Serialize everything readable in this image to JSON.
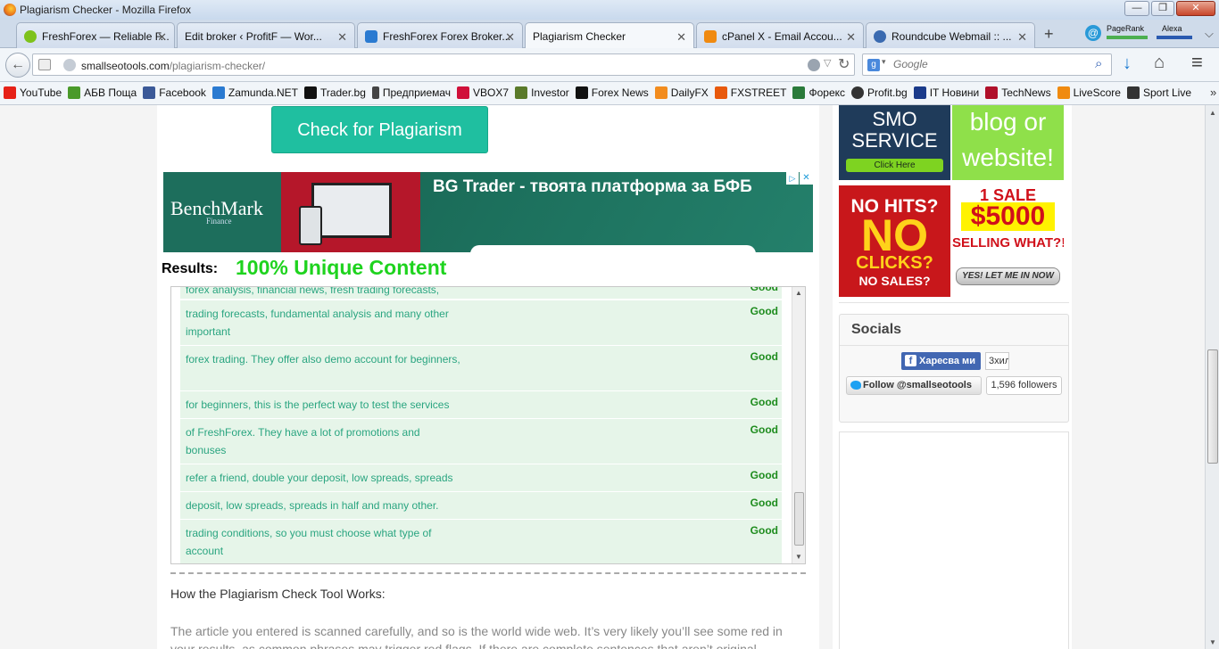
{
  "window": {
    "title": "Plagiarism Checker - Mozilla Firefox",
    "minimize": "—",
    "maximize": "❐",
    "close": "✕"
  },
  "tabs": [
    {
      "label": "FreshForex — Reliable F...",
      "close": "✕"
    },
    {
      "label": "Edit broker ‹ ProfitF — Wor...",
      "close": "✕"
    },
    {
      "label": "FreshForex Forex Broker...",
      "close": "✕"
    },
    {
      "label": "Plagiarism Checker",
      "close": "✕"
    },
    {
      "label": "cPanel X - Email Accou...",
      "close": "✕"
    },
    {
      "label": "Roundcube Webmail :: ...",
      "close": "✕"
    }
  ],
  "tabbar": {
    "new_tab": "+",
    "pagerank": "PageRank",
    "alexa": "Alexa",
    "list_tabs": "⌵"
  },
  "nav": {
    "back": "←",
    "url_domain": "smallseotools.com",
    "url_path": "/plagiarism-checker/",
    "search_placeholder": "Google",
    "downloads": "↓",
    "home": "⌂",
    "menu": "≡"
  },
  "bookmarks": [
    {
      "label": "YouTube",
      "color": "#e62117"
    },
    {
      "label": "АБВ Поща",
      "color": "#4a9a2a"
    },
    {
      "label": "Facebook",
      "color": "#3b5998"
    },
    {
      "label": "Zamunda.NET",
      "color": "#2a7ad1"
    },
    {
      "label": "Trader.bg",
      "color": "#111111"
    },
    {
      "label": "Предприемач",
      "color": "#444444"
    },
    {
      "label": "VBOX7",
      "color": "#d0103a"
    },
    {
      "label": "Investor",
      "color": "#5a7a2a"
    },
    {
      "label": "Forex News",
      "color": "#111111"
    },
    {
      "label": "DailyFX",
      "color": "#f28c1e"
    },
    {
      "label": "FXSTREET",
      "color": "#e8590c"
    },
    {
      "label": "Форекс",
      "color": "#2a7a3a"
    },
    {
      "label": "Profit.bg",
      "color": "#333333"
    },
    {
      "label": "IT Новини",
      "color": "#1a3a8a"
    },
    {
      "label": "TechNews",
      "color": "#b0102a"
    },
    {
      "label": "LiveScore",
      "color": "#f08a10"
    },
    {
      "label": "Sport Live",
      "color": "#333333"
    }
  ],
  "bookmarks_more": "»",
  "main": {
    "check_button": "Check for Plagiarism",
    "ad": {
      "brand": "BenchMark",
      "brand_sub": "Finance",
      "headline": "BG Trader - твоята платформа за БФБ",
      "ad_choices": "▷",
      "ad_close": "✕"
    },
    "results_label": "Results:",
    "results_summary": "100% Unique Content",
    "results": [
      {
        "text": "forex analysis, financial news, fresh trading forecasts,",
        "status": "Good"
      },
      {
        "text": "trading forecasts, fundamental analysis and many other important",
        "status": "Good"
      },
      {
        "text": "forex trading. They offer also demo account for beginners,",
        "status": "Good"
      },
      {
        "text": "for beginners, this is the perfect way to test the services",
        "status": "Good"
      },
      {
        "text": "of FreshForex. They have a lot of promotions and bonuses",
        "status": "Good"
      },
      {
        "text": "refer a friend, double your deposit, low spreads, spreads",
        "status": "Good"
      },
      {
        "text": "deposit, low spreads, spreads in half and many other.",
        "status": "Good"
      },
      {
        "text": "trading conditions, so you must choose what type of account",
        "status": "Good"
      }
    ],
    "results_scroll": {
      "up": "▲",
      "down": "▼"
    },
    "how_heading": "How the Plagiarism Check Tool Works:",
    "how_text": "The article you entered is scanned carefully, and so is the world wide web. It’s very likely you’ll see some red in your results, as common phrases may trigger red flags. If there are complete sentences that aren’t original"
  },
  "sidebar": {
    "ads": [
      {
        "line1": "SMO",
        "line2": "SERVICE",
        "button": "Click Here"
      },
      {
        "line1": "blog or",
        "line2": "website!"
      },
      {
        "line1": "NO HITS?",
        "line2": "NO",
        "line3": "CLICKS?",
        "line4": "NO SALES?"
      },
      {
        "line1": "1 SALE",
        "line2": "$5000",
        "line3": "SELLING WHAT?!",
        "button": "YES! LET ME IN NOW"
      }
    ],
    "socials": {
      "heading": "Socials",
      "fb_like": "Харесва ми",
      "fb_count": "3хил",
      "tw_follow": "Follow @smallseotools",
      "tw_count": "1,596 followers"
    }
  },
  "page_scroll": {
    "up": "▲",
    "down": "▼"
  }
}
